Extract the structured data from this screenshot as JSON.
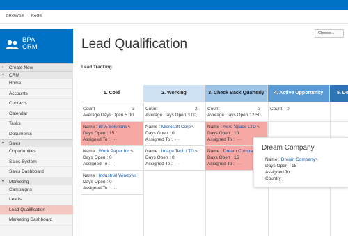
{
  "ribbon": {
    "tabs": [
      "BROWSE",
      "PAGE"
    ]
  },
  "logo": {
    "line1": "BPA",
    "line2": "CRM"
  },
  "nav": {
    "create_new": "Create New",
    "sections": [
      {
        "title": "CRM",
        "items": [
          "Home",
          "Accounts",
          "Contacts",
          "Calendar",
          "Tasks",
          "Documents"
        ]
      },
      {
        "title": "Sales",
        "items": [
          "Opportunities",
          "Sales System",
          "Sales Dashboard"
        ]
      },
      {
        "title": "Marketing",
        "items": [
          "Campaigns",
          "Leads",
          "Lead Qualification",
          "Marketing Dashboard"
        ]
      }
    ],
    "active_item": "Lead Qualification"
  },
  "page": {
    "title": "Lead Qualification",
    "choose_button": "Choose...",
    "subtitle": "Lead Tracking"
  },
  "columns": [
    {
      "title": "1. Cold",
      "color": "#ffffff",
      "count_label": "Count",
      "count": "3",
      "avg_label": "Average Days Open",
      "avg": "5.00"
    },
    {
      "title": "2. Working",
      "color": "#cfe2f3",
      "count_label": "Count",
      "count": "2",
      "avg_label": "Average Days Open",
      "avg": "3.00"
    },
    {
      "title": "3. Check Back Quarterly",
      "color": "#9dc3e6",
      "count_label": "Count",
      "count": "3",
      "avg_label": "Average Days Open",
      "avg": "12.50"
    },
    {
      "title": "4. Active Opportunity",
      "color": "#5b9bd5",
      "count_label": "Count",
      "count": "0",
      "avg_label": "",
      "avg": ""
    },
    {
      "title": "5. De",
      "color": "#2e75b6",
      "count_label": "",
      "count": "",
      "avg_label": "",
      "avg": ""
    }
  ],
  "cards": {
    "labels": {
      "name": "Name :",
      "days_open": "Days Open :",
      "assigned_to": "Assigned To :",
      "more": "···"
    },
    "col1": [
      {
        "name": "BPA Solutions",
        "days": "15",
        "assigned": "",
        "highlight": true
      },
      {
        "name": "Work Paper Inc",
        "days": "0",
        "assigned": "",
        "highlight": false
      },
      {
        "name": "Industrial Windows",
        "days": "0",
        "assigned": "",
        "highlight": false
      }
    ],
    "col2": [
      {
        "name": "Microsoft Corp",
        "days": "0",
        "assigned": "",
        "highlight": false
      },
      {
        "name": "Image Tech LTD",
        "days": "0",
        "assigned": "",
        "highlight": false
      }
    ],
    "col3": [
      {
        "name": "Aero Space LTD",
        "days": "10",
        "assigned": "",
        "highlight": true
      },
      {
        "name": "Dream Compa",
        "days": "15",
        "assigned": "",
        "highlight": true
      }
    ]
  },
  "popup": {
    "title": "Dream Company",
    "name_label": "Name :",
    "name": "Dream Company",
    "days_label": "Days Open :",
    "days": "15",
    "assigned_label": "Assigned To :",
    "country_label": "Country :"
  }
}
